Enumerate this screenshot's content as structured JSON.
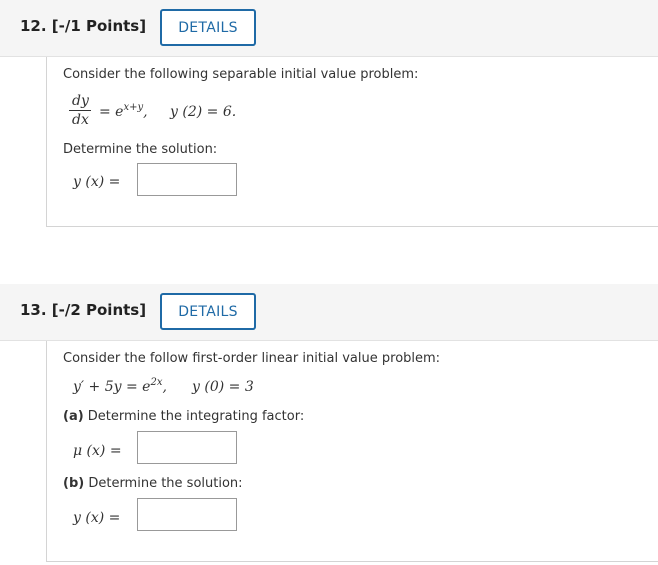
{
  "q12": {
    "title": "12. [-/1 Points]",
    "details_label": "DETAILS",
    "prompt": "Consider the following separable initial value problem:",
    "eq_num": "dy",
    "eq_den": "dx",
    "eq_rhs_base": "= e",
    "eq_rhs_exp": "x+y",
    "eq_comma": ",",
    "eq_ic": "y (2) = 6.",
    "instruction": "Determine the solution:",
    "answer_label": "y (x) =",
    "answer_value": ""
  },
  "q13": {
    "title": "13. [-/2 Points]",
    "details_label": "DETAILS",
    "prompt": "Consider the follow first-order linear initial value problem:",
    "eq_lhs": "y′ + 5y = e",
    "eq_exp": "2x",
    "eq_comma": ",",
    "eq_ic": "y (0) = 3",
    "part_a_tag": "(a)",
    "part_a_text": " Determine the integrating factor:",
    "answer_a_label": "μ (x) =",
    "answer_a_value": "",
    "part_b_tag": "(b)",
    "part_b_text": " Determine the solution:",
    "answer_b_label": "y (x) =",
    "answer_b_value": ""
  }
}
